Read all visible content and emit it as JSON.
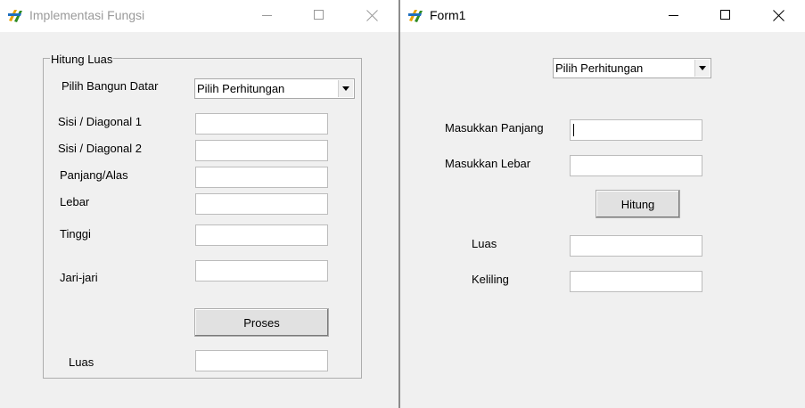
{
  "window1": {
    "title": "Implementasi Fungsi",
    "group_title": "Hitung Luas",
    "bangun_label": "Pilih Bangun Datar",
    "bangun_combo_value": "Pilih Perhitungan",
    "labels": {
      "sisi1": "Sisi / Diagonal 1",
      "sisi2": "Sisi / Diagonal 2",
      "panjang": "Panjang/Alas",
      "lebar": "Lebar",
      "tinggi": "Tinggi",
      "jari": "Jari-jari",
      "luas": "Luas"
    },
    "proses_button": "Proses"
  },
  "window2": {
    "title": "Form1",
    "combo_value": "Pilih Perhitungan",
    "labels": {
      "panjang": "Masukkan Panjang",
      "lebar": "Masukkan Lebar",
      "luas": "Luas",
      "keliling": "Keliling"
    },
    "hitung_button": "Hitung"
  },
  "icons": {
    "app": "app-form-icon",
    "minimize": "minimize-icon",
    "maximize": "maximize-icon",
    "close": "close-icon",
    "dropdown": "chevron-down-icon"
  }
}
